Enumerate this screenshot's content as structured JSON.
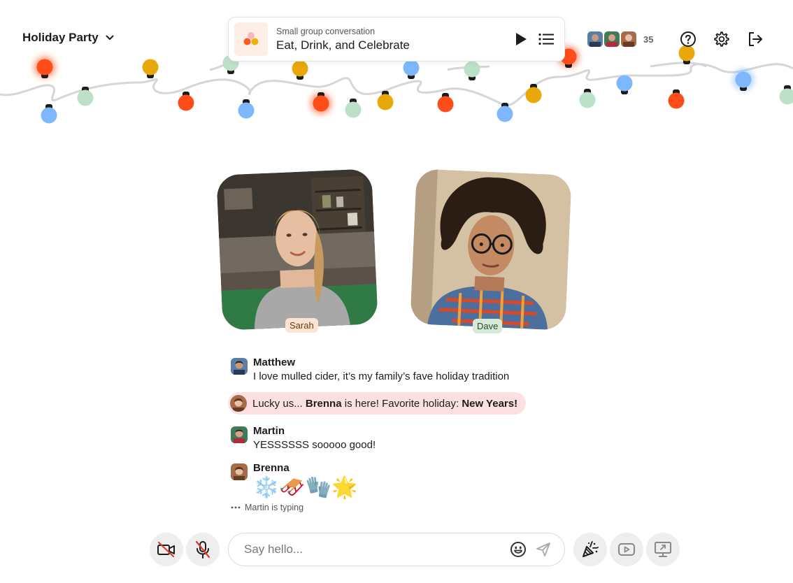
{
  "header": {
    "event_title": "Holiday Party",
    "activity": {
      "subtitle": "Small group conversation",
      "title": "Eat, Drink, and Celebrate"
    },
    "participant_count": "35"
  },
  "video": {
    "tiles": [
      {
        "name": "Sarah",
        "tag_color": "#fbe4d1"
      },
      {
        "name": "Dave",
        "tag_color": "#d7ead8"
      }
    ]
  },
  "chat": {
    "messages": [
      {
        "author": "Matthew",
        "text": "I love mulled cider, it’s my family’s fave holiday tradition"
      },
      {
        "author": "Martin",
        "text": "YESSSSSS sooooo good!"
      },
      {
        "author": "Brenna",
        "text": "❄️🛷🧤🌟"
      }
    ],
    "notice": {
      "prefix": "Lucky us... ",
      "name": "Brenna",
      "middle": " is here! Favorite holiday: ",
      "highlight": "New Years!",
      "bg": "#fde0e2"
    },
    "typing": "Martin is typing"
  },
  "composer": {
    "placeholder": "Say hello..."
  },
  "icons": {
    "dropdown": "chevron-down-icon",
    "play": "play-icon",
    "list": "list-icon",
    "help": "help-icon",
    "settings": "gear-icon",
    "leave": "exit-icon",
    "camera": "camera-off-icon",
    "mic": "mic-off-icon",
    "emoji": "emoji-icon",
    "send": "send-icon",
    "celebrate": "confetti-icon",
    "youtube": "video-share-icon",
    "screen": "screen-share-icon"
  },
  "colors": {
    "bulb_red": "#ff4d1a",
    "bulb_yellow": "#e8a80a",
    "bulb_blue": "#7db8ff",
    "bulb_green": "#bde0c8"
  }
}
